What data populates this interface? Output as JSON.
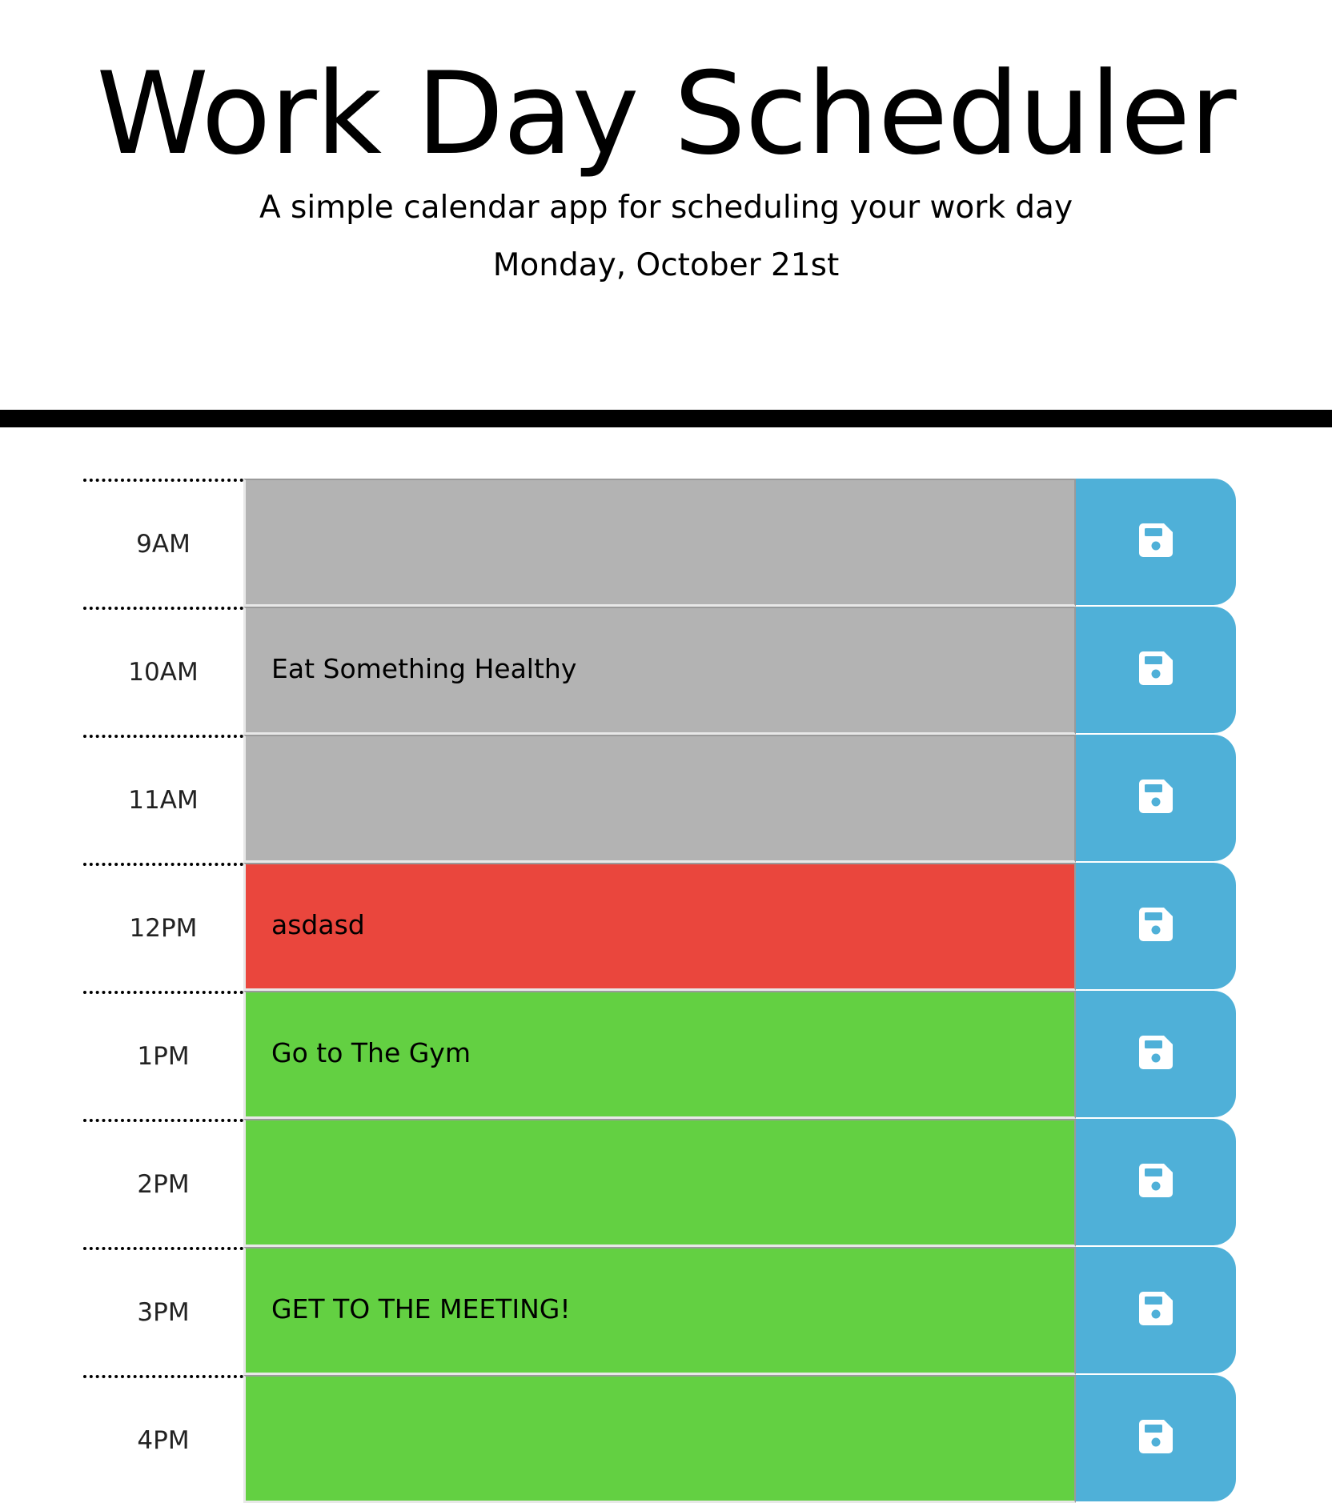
{
  "header": {
    "title": "Work Day Scheduler",
    "subtitle": "A simple calendar app for scheduling your work day",
    "current_day": "Monday, October 21st"
  },
  "colors": {
    "past": "#b3b3b3",
    "present": "#ea463d",
    "future": "#63d042",
    "save_button": "#4fb0d8",
    "save_icon": "#ffffff"
  },
  "icons": {
    "save": "floppy-disk-icon"
  },
  "timeblocks": [
    {
      "hour": "9AM",
      "description": "",
      "state": "past"
    },
    {
      "hour": "10AM",
      "description": "Eat Something Healthy",
      "state": "past"
    },
    {
      "hour": "11AM",
      "description": "",
      "state": "past"
    },
    {
      "hour": "12PM",
      "description": "asdasd",
      "state": "present"
    },
    {
      "hour": "1PM",
      "description": "Go to The Gym",
      "state": "future"
    },
    {
      "hour": "2PM",
      "description": "",
      "state": "future"
    },
    {
      "hour": "3PM",
      "description": "GET TO THE MEETING!",
      "state": "future"
    },
    {
      "hour": "4PM",
      "description": "",
      "state": "future"
    }
  ]
}
